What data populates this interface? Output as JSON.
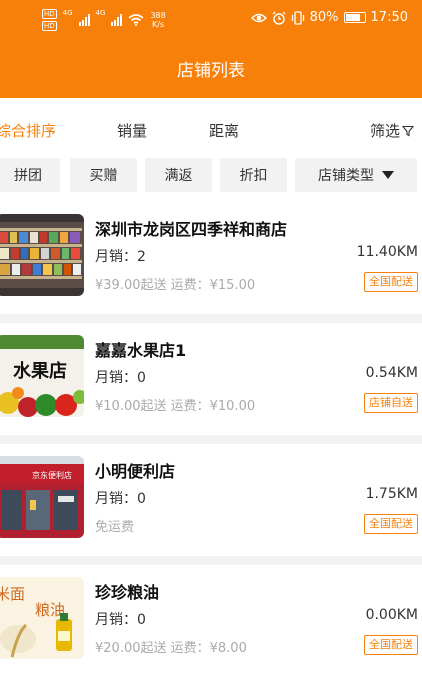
{
  "status": {
    "net_tag_1": "HD",
    "net_tag_2": "HD",
    "sig_1": "4G",
    "sig_2": "4G",
    "speed_value": "388",
    "speed_unit": "K/s",
    "battery_text": "80%",
    "battery_level": 0.8,
    "time": "17:50"
  },
  "header": {
    "title": "店铺列表"
  },
  "sort": {
    "items": [
      {
        "label": "综合排序",
        "active": true
      },
      {
        "label": "销量"
      },
      {
        "label": "距离"
      },
      {
        "label": "筛选"
      }
    ],
    "filter_icon": "funnel-icon"
  },
  "filters": {
    "chips": [
      "拼团",
      "买赠",
      "满返",
      "折扣"
    ],
    "type_select": "店铺类型",
    "dropdown_icon": "triangle-down-icon"
  },
  "stores": [
    {
      "name": "深圳市龙岗区四季祥和商店",
      "sales": "月销：2",
      "fee": "¥39.00起送 运费：¥15.00",
      "distance": "11.40KM",
      "delivery": "全国配送",
      "thumb_icon": "store-shelves-photo"
    },
    {
      "name": "嘉嘉水果店1",
      "sales": "月销：0",
      "fee": "¥10.00起送 运费：¥10.00",
      "distance": "0.54KM",
      "delivery": "店铺自送",
      "thumb_text": "水果店",
      "thumb_icon": "fruit-store-photo"
    },
    {
      "name": "小明便利店",
      "sales": "月销：0",
      "fee": "免运费",
      "distance": "1.75KM",
      "delivery": "全国配送",
      "thumb_text": "京东便利店",
      "thumb_icon": "convenience-store-photo"
    },
    {
      "name": "珍珍粮油",
      "sales": "月销：0",
      "fee": "¥20.00起送 运费：¥8.00",
      "distance": "0.00KM",
      "delivery": "全国配送",
      "thumb_text_1": "米面",
      "thumb_text_2": "粮油",
      "thumb_icon": "grain-oil-photo"
    }
  ],
  "colors": {
    "brand": "#f7800a",
    "background": "#f2f2f2"
  }
}
